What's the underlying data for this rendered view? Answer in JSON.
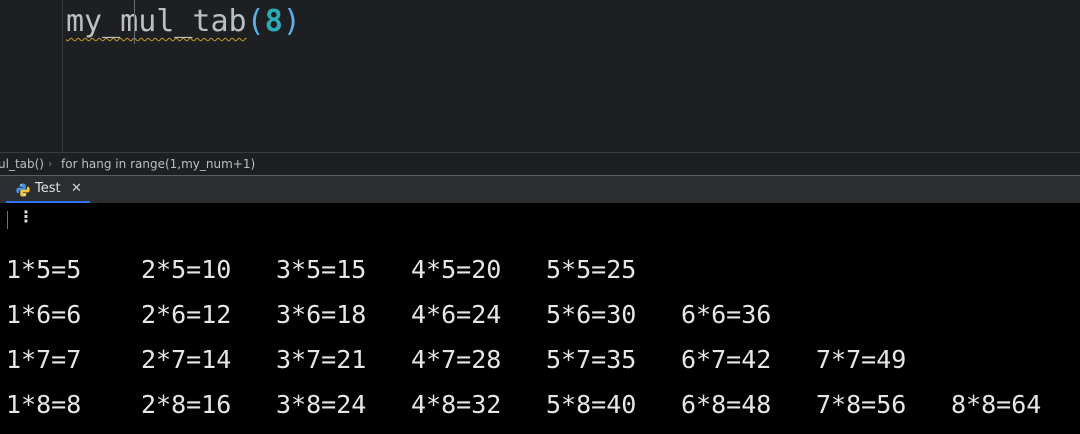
{
  "editor": {
    "code": {
      "function_name": "my_mul_tab",
      "open_paren": "(",
      "argument": "8",
      "close_paren": ")"
    }
  },
  "breadcrumb": {
    "items": [
      "ul_tab()",
      "for hang in range(1,my_num+1)"
    ],
    "separator": "›"
  },
  "run_tab": {
    "label": "Test",
    "icon": "python-icon",
    "close": "✕"
  },
  "console": {
    "more_options": "⋮",
    "rows": [
      [
        "1*5=5",
        "2*5=10",
        "3*5=15",
        "4*5=20",
        "5*5=25"
      ],
      [
        "1*6=6",
        "2*6=12",
        "3*6=18",
        "4*6=24",
        "5*6=30",
        "6*6=36"
      ],
      [
        "1*7=7",
        "2*7=14",
        "3*7=21",
        "4*7=28",
        "5*7=35",
        "6*7=42",
        "7*7=49"
      ],
      [
        "1*8=8",
        "2*8=16",
        "3*8=24",
        "4*8=32",
        "5*8=40",
        "6*8=48",
        "7*8=56",
        "8*8=64"
      ]
    ]
  },
  "colors": {
    "editor_bg": "#1e1f22",
    "console_bg": "#000000",
    "number_literal": "#2aacb8",
    "paren": "#5ab0e8",
    "tab_accent": "#3574f0",
    "warning_underline": "#c8a021"
  }
}
